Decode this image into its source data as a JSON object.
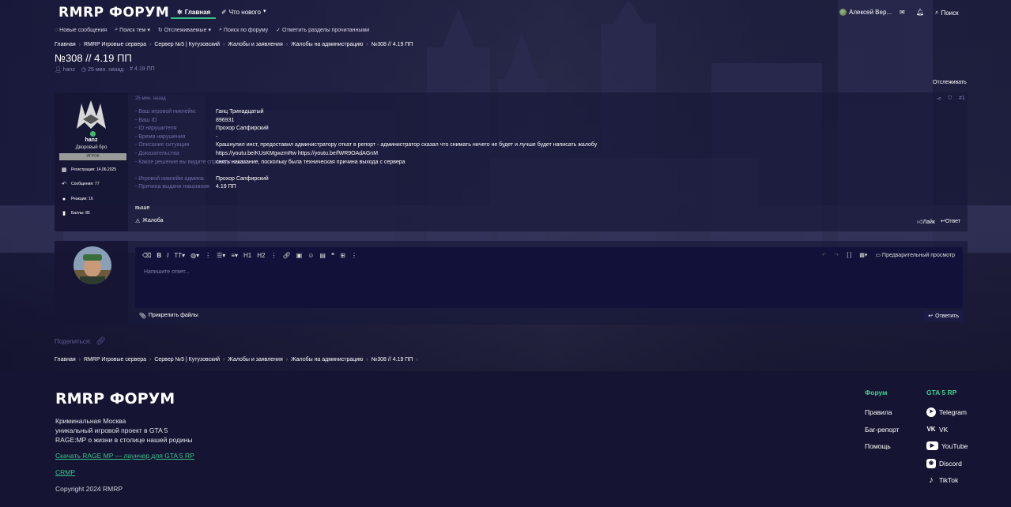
{
  "header": {
    "logo": "RMRP ФОРУМ",
    "nav": {
      "home": "Главная",
      "whats_new": "Что нового"
    },
    "user": "Алексей Вер...",
    "search": "Поиск"
  },
  "subnav": [
    "Новые сообщения",
    "Поиск тем",
    "Отслеживаемые",
    "Поиск по форуму",
    "Отметить разделы прочитанными"
  ],
  "breadcrumbs": [
    "Главная",
    "RMRP Игровые сервера",
    "Сервер №5 | Кутузовский",
    "Жалобы и заявления",
    "Жалобы на администрацию",
    "№308 // 4.19 ПП"
  ],
  "thread": {
    "title": "№308 // 4.19 ПП",
    "meta": {
      "author": "hanz",
      "date": "25 мин. назад",
      "tag": "4.19 ПП"
    },
    "follow": "Отслеживать"
  },
  "post": {
    "user": {
      "name": "hanz",
      "title": "Дворовый бро",
      "role": "ИГРОК",
      "stats": [
        {
          "icon": "calendar-icon",
          "text": "Регистрация: 14.06.2025"
        },
        {
          "icon": "messages-icon",
          "text": "Сообщения: 77"
        },
        {
          "icon": "reactions-icon",
          "text": "Реакции: 16"
        },
        {
          "icon": "points-icon",
          "text": "Баллы: 85"
        }
      ]
    },
    "date": "25 мин. назад",
    "number": "#1",
    "fields": [
      {
        "label": "- Ваш игровой никнейм:",
        "value": "Ганц Тринадцатый"
      },
      {
        "label": "- Ваш ID",
        "value": "896931"
      },
      {
        "label": "- ID нарушителя",
        "value": "Прохор Сапфирский"
      },
      {
        "label": "- Время нарушения",
        "value": "-"
      },
      {
        "label": "- Описание ситуации",
        "value": "Крашнулил инст, предоставил администратору откат в репорт - администратор сказал что снимать ничего не будет и лучше будет написать жалобу"
      },
      {
        "label": "- Доказательства",
        "value": "https://youtu.be/KUsKMgwzmRw https://youtu.be/fWR9OAdAGnM"
      },
      {
        "label": "- Какое решение вы видите справедливым:",
        "value": "снять наказание, поскольку была техническая причина выхода с сервера"
      },
      {
        "label": "- Игровой никнейм админа",
        "value": "Прохор Сапфирский"
      },
      {
        "label": "- Причина выдачи наказания",
        "value": "4.19 ПП"
      }
    ],
    "below": "выше",
    "report": "Жалоба",
    "like": "Лайк",
    "reply": "Ответ"
  },
  "reply_box": {
    "placeholder": "Напишите ответ...",
    "preview": "Предварительный просмотр",
    "attach": "Прикрепить файлы",
    "submit": "Ответить",
    "toolbar": {
      "h1": "H1",
      "h2": "H2"
    }
  },
  "share": "Поделиться:",
  "footer": {
    "logo": "RMRP ФОРУМ",
    "desc": [
      "Криминальная Москва",
      "уникальный игровой проект в GTA 5",
      "RAGE:MP о жизни в столице нашей родины"
    ],
    "link1": "Скачать RAGE MP — лаунчер для GTA 5 RP",
    "link2": "CRMP",
    "copyright": "Copyright 2024 RMRP",
    "col1": {
      "title": "Форум",
      "items": [
        "Правила",
        "Баг-репорт",
        "Помощь"
      ]
    },
    "col2": {
      "title": "GTA 5 RP",
      "items": [
        "Telegram",
        "VK",
        "YouTube",
        "Discord",
        "TikTok"
      ]
    }
  }
}
